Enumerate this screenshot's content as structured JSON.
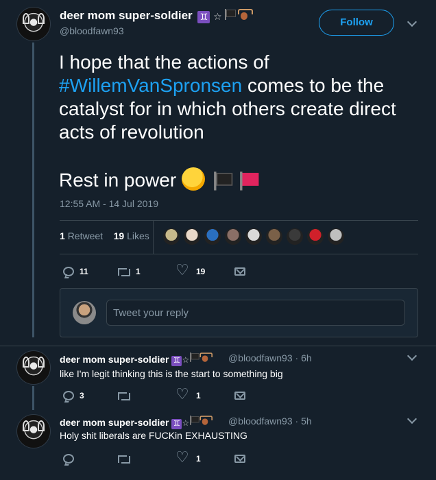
{
  "main_tweet": {
    "display_name": "deer mom super-soldier",
    "handle": "@bloodfawn93",
    "follow_label": "Follow",
    "text_before": "I hope that the actions of ",
    "hashtag": "#WillemVanSpronsen",
    "text_after": " comes to be the catalyst for in which others create direct acts of revolution",
    "text_line2": "Rest in power",
    "timestamp": "12:55 AM - 14 Jul 2019",
    "retweet_count": "1",
    "retweet_label": "Retweet",
    "like_count": "19",
    "like_label": "Likes",
    "liker_colors": [
      "#c7b98a",
      "#e9d8c8",
      "#2a6fbf",
      "#8a6f66",
      "#d9d9d9",
      "#7a6048",
      "#3a3a3a",
      "#d0202a",
      "#bfbfbf"
    ],
    "actions": {
      "replies": "11",
      "retweets": "1",
      "likes": "19"
    }
  },
  "reply_box": {
    "placeholder": "Tweet your reply"
  },
  "replies": [
    {
      "display_name": "deer mom super-soldier",
      "handle": "@bloodfawn93",
      "time": "· 6h",
      "text": "like I'm legit thinking this is the start to something big",
      "actions": {
        "replies": "3",
        "retweets": "",
        "likes": "1"
      }
    },
    {
      "display_name": "deer mom super-soldier",
      "handle": "@bloodfawn93",
      "time": "· 5h",
      "text": "Holy shit liberals are FUCKin EXHAUSTING",
      "actions": {
        "replies": "",
        "retweets": "",
        "likes": "1"
      }
    }
  ],
  "icons": [
    "reply-icon",
    "retweet-icon",
    "like-icon",
    "direct-message-icon",
    "chevron-down-icon",
    "gemini-emoji",
    "star-emoji",
    "black-flag-emoji",
    "deer-emoji",
    "raised-fist-emoji",
    "red-flag-emoji"
  ],
  "colors": {
    "background": "#15202b",
    "accent": "#1da1f2",
    "muted": "#8899a6",
    "border": "#38444d"
  }
}
